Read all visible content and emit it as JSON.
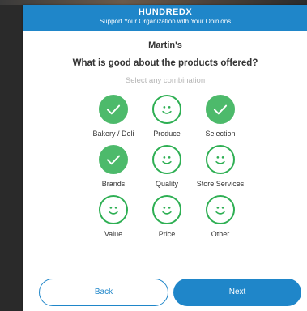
{
  "header": {
    "brand": "HUNDREDX",
    "tagline": "Support Your Organization with Your Opinions"
  },
  "survey": {
    "store": "Martin's",
    "question": "What is good about the products offered?",
    "hint": "Select any combination"
  },
  "options": [
    {
      "label": "Bakery / Deli",
      "selected": true
    },
    {
      "label": "Produce",
      "selected": false
    },
    {
      "label": "Selection",
      "selected": true
    },
    {
      "label": "Brands",
      "selected": true
    },
    {
      "label": "Quality",
      "selected": false
    },
    {
      "label": "Store Services",
      "selected": false
    },
    {
      "label": "Value",
      "selected": false
    },
    {
      "label": "Price",
      "selected": false
    },
    {
      "label": "Other",
      "selected": false
    }
  ],
  "footer": {
    "back_label": "Back",
    "next_label": "Next"
  },
  "colors": {
    "brand_blue": "#1f86c9",
    "selected_green": "#4dba6b",
    "outline_green": "#2eaf53"
  },
  "icons": {
    "selected": "checkmark-icon",
    "unselected": "smiley-icon"
  }
}
